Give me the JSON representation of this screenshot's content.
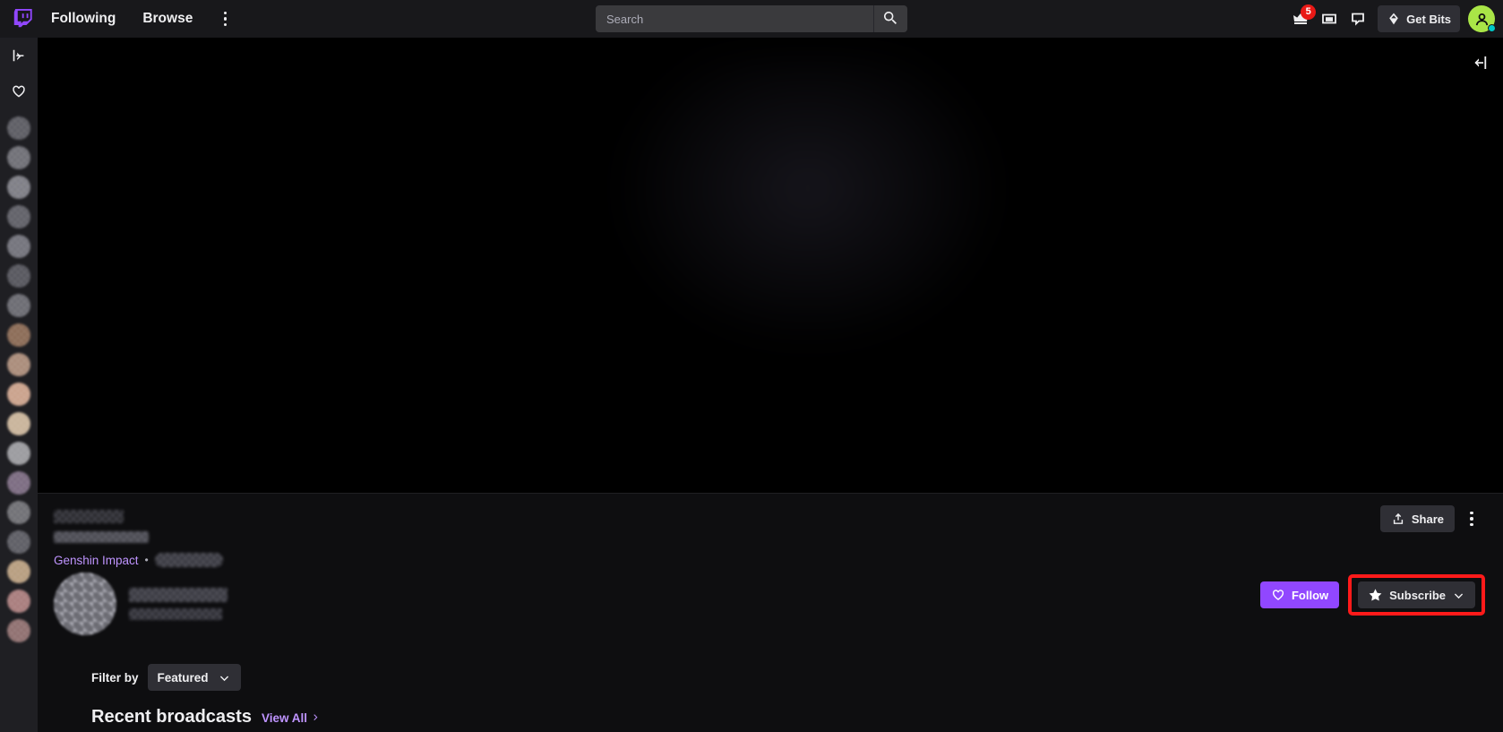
{
  "nav": {
    "logo_icon": "twitch-logo-icon",
    "links": [
      {
        "label": "Following",
        "name": "nav-link-following"
      },
      {
        "label": "Browse",
        "name": "nav-link-browse"
      }
    ],
    "kebab_icon": "more-vertical-icon",
    "search": {
      "placeholder": "Search",
      "value": "",
      "button_icon": "search-icon"
    },
    "right": {
      "prime_icon": "crown-prime-icon",
      "prime_badge": "5",
      "whispers_icon": "inbox-mail-icon",
      "notifications_icon": "chat-bubble-icon",
      "bits_label": "Get Bits",
      "bits_icon": "bits-diamond-icon",
      "avatar_icon": "user-avatar-icon",
      "avatar_color": "#a9e547",
      "status_color": "#00c8c8"
    }
  },
  "sidebar": {
    "expand_icon": "expand-sidebar-icon",
    "followed_icon": "heart-icon",
    "channels": [
      {
        "name": "sidebar-channel-1"
      },
      {
        "name": "sidebar-channel-2"
      },
      {
        "name": "sidebar-channel-3"
      },
      {
        "name": "sidebar-channel-4"
      },
      {
        "name": "sidebar-channel-5"
      },
      {
        "name": "sidebar-channel-6"
      },
      {
        "name": "sidebar-channel-7"
      },
      {
        "name": "sidebar-channel-8"
      },
      {
        "name": "sidebar-channel-9"
      },
      {
        "name": "sidebar-channel-10"
      },
      {
        "name": "sidebar-channel-11"
      },
      {
        "name": "sidebar-channel-12"
      },
      {
        "name": "sidebar-channel-13"
      },
      {
        "name": "sidebar-channel-14"
      },
      {
        "name": "sidebar-channel-15"
      },
      {
        "name": "sidebar-channel-16"
      },
      {
        "name": "sidebar-channel-17"
      },
      {
        "name": "sidebar-channel-18"
      }
    ]
  },
  "player": {
    "collapse_chat_icon": "collapse-chat-icon"
  },
  "stream": {
    "title_redacted": true,
    "subtitle_redacted": true,
    "category": "Genshin Impact",
    "separator": "•",
    "tag_redacted": true,
    "share_label": "Share",
    "share_icon": "share-upload-icon",
    "more_icon": "more-vertical-icon"
  },
  "channel": {
    "avatar_redacted": true,
    "display_name_redacted": true,
    "login_name_redacted": true,
    "follow_label": "Follow",
    "follow_icon": "heart-icon",
    "follow_color": "#9147ff",
    "subscribe_label": "Subscribe",
    "subscribe_icon": "star-icon",
    "subscribe_chevron_icon": "chevron-down-icon",
    "highlight_color": "#ff1a1a"
  },
  "content": {
    "filter_label": "Filter by",
    "filter_value": "Featured",
    "filter_chevron_icon": "chevron-down-icon",
    "recent_title": "Recent broadcasts",
    "view_all_label": "View All",
    "view_all_icon": "chevron-right-icon"
  }
}
